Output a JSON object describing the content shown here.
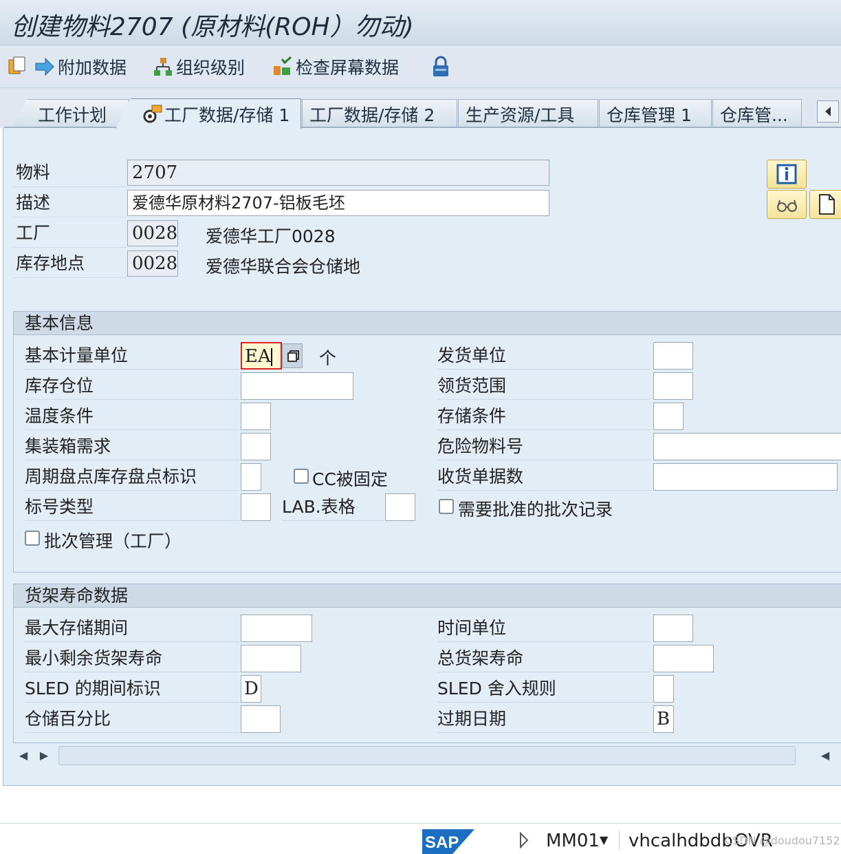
{
  "title": "创建物料2707 (原材料(ROH）勿动)",
  "toolbar": {
    "add_data": "附加数据",
    "org_levels": "组织级别",
    "check_screen": "检查屏幕数据"
  },
  "tabs": [
    {
      "label": "工作计划"
    },
    {
      "label": "工厂数据/存储 1"
    },
    {
      "label": "工厂数据/存储 2"
    },
    {
      "label": "生产资源/工具"
    },
    {
      "label": "仓库管理 1"
    },
    {
      "label": "仓库管..."
    }
  ],
  "header": {
    "material_label": "物料",
    "material_value": "2707",
    "desc_label": "描述",
    "desc_value": "爱德华原材料2707-铝板毛坯",
    "plant_label": "工厂",
    "plant_value": "0028",
    "plant_desc": "爱德华工厂0028",
    "sloc_label": "库存地点",
    "sloc_value": "0028",
    "sloc_desc": "爱德华联合会仓储地"
  },
  "basic": {
    "title": "基本信息",
    "base_uom_label": "基本计量单位",
    "base_uom_value": "EA",
    "base_uom_text": "个",
    "bin_label": "库存仓位",
    "temp_label": "温度条件",
    "container_label": "集装箱需求",
    "cc_label": "周期盘点库存盘点标识",
    "cc_fixed_label": "CC被固定",
    "label_type_label": "标号类型",
    "lab_form_label": "LAB.表格",
    "batch_label": "批次管理（工厂）",
    "issue_unit_label": "发货单位",
    "pick_area_label": "领货范围",
    "storage_cond_label": "存储条件",
    "haz_label": "危险物料号",
    "gr_slips_label": "收货单据数",
    "approved_batch_label": "需要批准的批次记录"
  },
  "shelf": {
    "title": "货架寿命数据",
    "max_storage_label": "最大存储期间",
    "min_shelf_label": "最小剩余货架寿命",
    "sled_period_label": "SLED 的期间标识",
    "sled_period_value": "D",
    "storage_pct_label": "仓储百分比",
    "time_unit_label": "时间单位",
    "total_shelf_label": "总货架寿命",
    "sled_round_label": "SLED 舍入规则",
    "expiry_label": "过期日期",
    "expiry_value": "B"
  },
  "status": {
    "tcode": "MM01",
    "server": "vhcalhdbdb",
    "mode": "OVR",
    "watermark": "CSDN @doudou7152"
  },
  "colors": {
    "accent_yellow": "#f4e39a",
    "tab_bg": "#dfe8f0",
    "content_bg": "#e3edf6",
    "focus_border": "#d22"
  }
}
